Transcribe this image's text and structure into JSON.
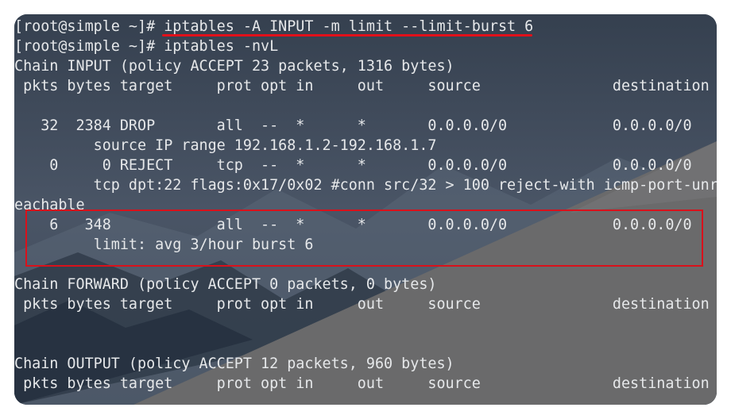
{
  "terminal": {
    "lines": [
      "[root@simple ~]# iptables -A INPUT -m limit --limit-burst 6",
      "[root@simple ~]# iptables -nvL",
      "Chain INPUT (policy ACCEPT 23 packets, 1316 bytes)",
      " pkts bytes target     prot opt in     out     source               destination",
      "",
      "   32  2384 DROP       all  --  *      *       0.0.0.0/0            0.0.0.0/0",
      "         source IP range 192.168.1.2-192.168.1.7",
      "    0     0 REJECT     tcp  --  *      *       0.0.0.0/0            0.0.0.0/0",
      "         tcp dpt:22 flags:0x17/0x02 #conn src/32 > 100 reject-with icmp-port-unr",
      "eachable",
      "    6   348            all  --  *      *       0.0.0.0/0            0.0.0.0/0",
      "         limit: avg 3/hour burst 6",
      "",
      "Chain FORWARD (policy ACCEPT 0 packets, 0 bytes)",
      " pkts bytes target     prot opt in     out     source               destination",
      "",
      "",
      "Chain OUTPUT (policy ACCEPT 12 packets, 960 bytes)",
      " pkts bytes target     prot opt in     out     source               destination"
    ]
  },
  "colors": {
    "terminal_text": "#e6e8ea",
    "annotation_red": "#e1101a",
    "background_dark": "#3f4a59",
    "background_slope": "#6a6a6b"
  }
}
